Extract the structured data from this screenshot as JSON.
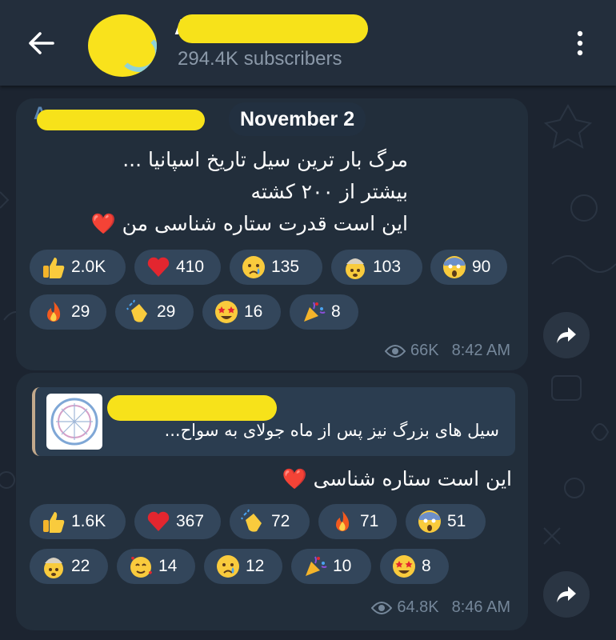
{
  "header": {
    "channel_name": "A",
    "subscribers": "294.4K subscribers",
    "back_icon": "arrow-left-icon",
    "menu_icon": "more-vertical-icon"
  },
  "date_separator": "November 2",
  "messages": [
    {
      "sender": "A",
      "lines": [
        "مرگ بار ترین سیل تاریخ اسپانیا ...",
        "بیشتر از ۲۰۰ کشته",
        "این است قدرت ستاره شناسی من ❤️"
      ],
      "reactions": [
        {
          "emoji": "thumbs-up",
          "count": "2.0K"
        },
        {
          "emoji": "red-heart",
          "count": "410"
        },
        {
          "emoji": "crying-face",
          "count": "135"
        },
        {
          "emoji": "exploding-head",
          "count": "103"
        },
        {
          "emoji": "screaming-face",
          "count": "90"
        },
        {
          "emoji": "fire",
          "count": "29"
        },
        {
          "emoji": "clapping-hands",
          "count": "29"
        },
        {
          "emoji": "star-struck",
          "count": "16"
        },
        {
          "emoji": "party-popper",
          "count": "8"
        }
      ],
      "views": "66K",
      "time": "8:42 AM"
    },
    {
      "reply_quote": {
        "text": "سیل های بزرگ نیز پس از ماه جولای به سواح..."
      },
      "lines": [
        "این است ستاره شناسی ❤️"
      ],
      "reactions": [
        {
          "emoji": "thumbs-up",
          "count": "1.6K"
        },
        {
          "emoji": "red-heart",
          "count": "367"
        },
        {
          "emoji": "clapping-hands",
          "count": "72"
        },
        {
          "emoji": "fire",
          "count": "71"
        },
        {
          "emoji": "screaming-face",
          "count": "51"
        },
        {
          "emoji": "exploding-head",
          "count": "22"
        },
        {
          "emoji": "smiling-face-with-hearts",
          "count": "14"
        },
        {
          "emoji": "crying-face",
          "count": "12"
        },
        {
          "emoji": "party-popper",
          "count": "10"
        },
        {
          "emoji": "star-struck",
          "count": "8"
        }
      ],
      "views": "64.8K",
      "time": "8:46 AM"
    }
  ],
  "colors": {
    "background": "#1c2430",
    "header": "#232e3c",
    "bubble": "#222e3b",
    "reaction_chip": "#33465b",
    "meta_text": "#75879a",
    "subscribers_text": "#8b99a9",
    "redaction": "#f7e21a"
  }
}
